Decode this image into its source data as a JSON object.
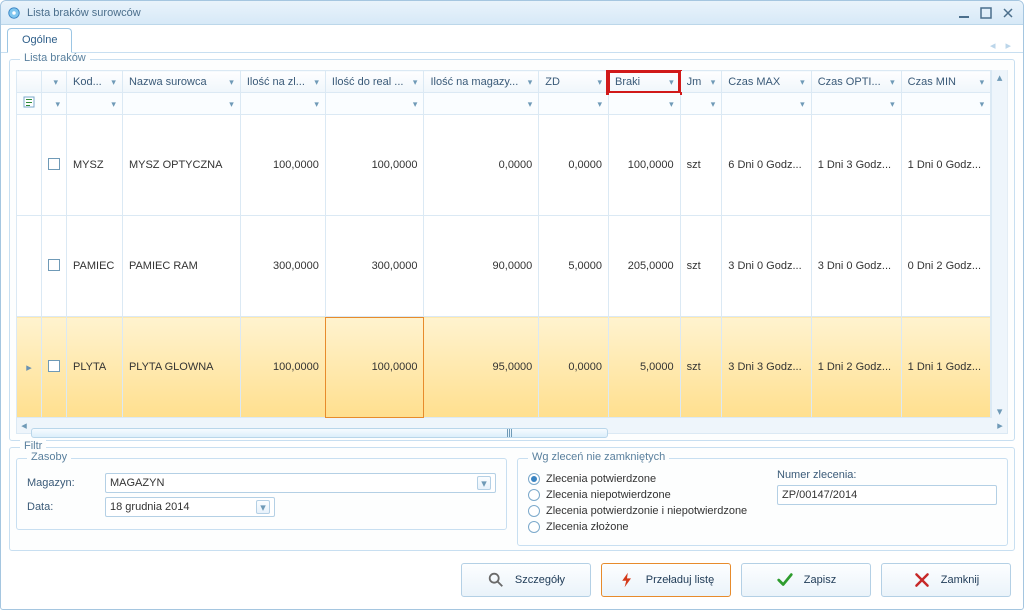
{
  "window_title": "Lista braków surowców",
  "tab_main": "Ogólne",
  "group_list": "Lista braków",
  "columns": {
    "kod": "Kod...",
    "nazwa": "Nazwa surowca",
    "ilosc_zl": "Ilość na zl...",
    "ilosc_real": "Ilość do real ...",
    "ilosc_mag": "Ilość na magazy...",
    "zd": "ZD",
    "braki": "Braki",
    "jm": "Jm",
    "czas_max": "Czas MAX",
    "czas_opt": "Czas OPTI...",
    "czas_min": "Czas MIN"
  },
  "rows": [
    {
      "kod": "MYSZ",
      "nazwa": "MYSZ OPTYCZNA",
      "zl": "100,0000",
      "real": "100,0000",
      "mag": "0,0000",
      "zd": "0,0000",
      "braki": "100,0000",
      "jm": "szt",
      "max": "6 Dni 0 Godz...",
      "opt": "1 Dni 3 Godz...",
      "min": "1 Dni 0 Godz..."
    },
    {
      "kod": "PAMIEC",
      "nazwa": "PAMIEC RAM",
      "zl": "300,0000",
      "real": "300,0000",
      "mag": "90,0000",
      "zd": "5,0000",
      "braki": "205,0000",
      "jm": "szt",
      "max": "3 Dni 0 Godz...",
      "opt": "3 Dni 0 Godz...",
      "min": "0 Dni 2 Godz..."
    },
    {
      "kod": "PLYTA",
      "nazwa": "PLYTA GLOWNA",
      "zl": "100,0000",
      "real": "100,0000",
      "mag": "95,0000",
      "zd": "0,0000",
      "braki": "5,0000",
      "jm": "szt",
      "max": "3 Dni 3 Godz...",
      "opt": "1 Dni 2 Godz...",
      "min": "1 Dni 1 Godz..."
    }
  ],
  "filtr_label": "Filtr",
  "zasoby": {
    "legend": "Zasoby",
    "magazyn_label": "Magazyn:",
    "magazyn_value": "MAGAZYN",
    "data_label": "Data:",
    "data_value": "18 grudnia 2014"
  },
  "zlecenia": {
    "legend": "Wg zleceń nie zamkniętych",
    "opt1": "Zlecenia potwierdzone",
    "opt2": "Zlecenia niepotwierdzone",
    "opt3": "Zlecenia potwierdzonie i niepotwierdzone",
    "opt4": "Zlecenia złożone",
    "numer_label": "Numer zlecenia:",
    "numer_value": "ZP/00147/2014"
  },
  "buttons": {
    "details": "Szczegóły",
    "reload": "Przeładuj listę",
    "save": "Zapisz",
    "close": "Zamknij"
  }
}
